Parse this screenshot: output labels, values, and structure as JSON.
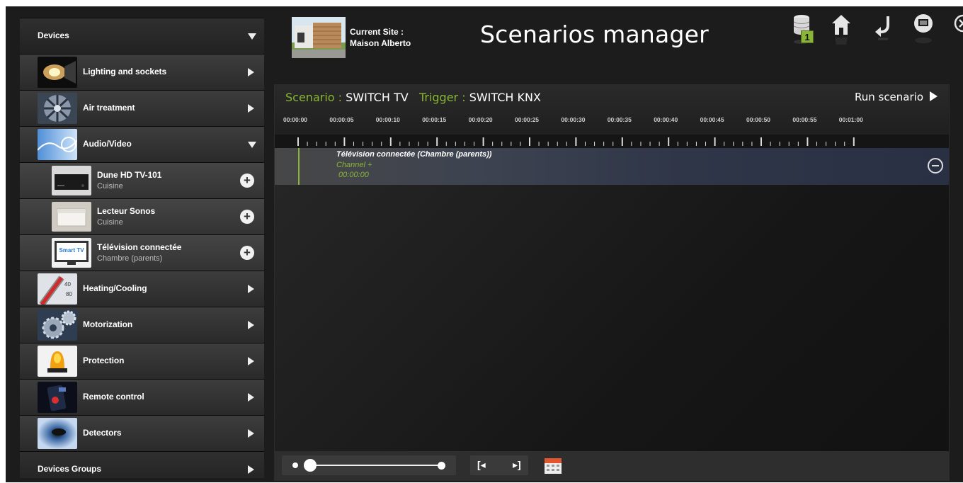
{
  "sidebar": {
    "header": "Devices",
    "items": [
      {
        "label": "Lighting and sockets",
        "expanded": false
      },
      {
        "label": "Air treatment",
        "expanded": false
      },
      {
        "label": "Audio/Video",
        "expanded": true
      },
      {
        "label": "Heating/Cooling",
        "expanded": false
      },
      {
        "label": "Motorization",
        "expanded": false
      },
      {
        "label": "Protection",
        "expanded": false
      },
      {
        "label": "Remote control",
        "expanded": false
      },
      {
        "label": "Detectors",
        "expanded": false
      }
    ],
    "audio_video_devices": [
      {
        "name": "Dune HD TV-101",
        "room": "Cuisine"
      },
      {
        "name": "Lecteur Sonos",
        "room": "Cuisine"
      },
      {
        "name": "Télévision connectée",
        "room": "Chambre (parents)",
        "thumb_text": "Smart TV"
      }
    ],
    "groups_label": "Devices Groups"
  },
  "site": {
    "label": "Current Site :",
    "name": "Maison Alberto"
  },
  "title": "Scenarios manager",
  "toolbar": {
    "database_badge": "1",
    "icons": [
      "database-icon",
      "home-icon",
      "back-icon",
      "display-icon",
      "close-icon"
    ]
  },
  "scenario": {
    "scenario_label": "Scenario :",
    "scenario_name": "SWITCH TV",
    "trigger_label": "Trigger :",
    "trigger_name": "SWITCH KNX",
    "run_label": "Run scenario"
  },
  "timeline": {
    "ticks": [
      "00:00:00",
      "00:00:05",
      "00:00:10",
      "00:00:15",
      "00:00:20",
      "00:00:25",
      "00:00:30",
      "00:00:35",
      "00:00:40",
      "00:00:45",
      "00:00:50",
      "00:00:55",
      "00:01:00"
    ],
    "track": {
      "device": "Télévision connectée (Chambre (parents))",
      "action": "Channel +",
      "time": "00:00:00"
    }
  },
  "colors": {
    "accent_green": "#8ab537",
    "panel_bg": "#161616",
    "sidebar_row": "#333333"
  }
}
